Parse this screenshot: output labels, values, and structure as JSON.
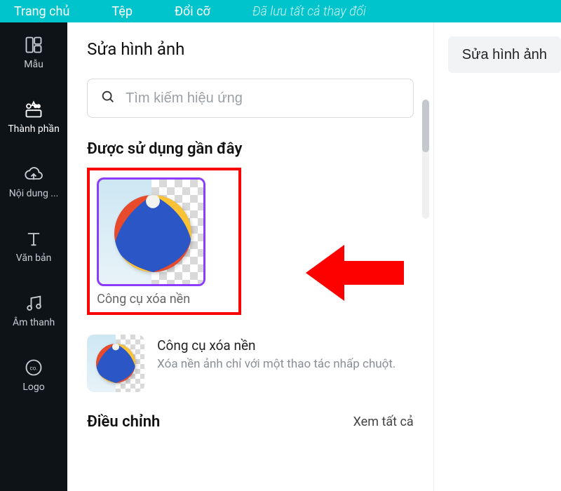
{
  "topbar": {
    "home": "Trang chủ",
    "file": "Tệp",
    "resize": "Đổi cỡ",
    "saved": "Đã lưu tất cả thay đổi"
  },
  "rail": {
    "templates": "Mẫu",
    "elements": "Thành phần",
    "uploads": "Nội dung ...",
    "text": "Văn bản",
    "audio": "Âm thanh",
    "logo": "Logo"
  },
  "panel": {
    "title": "Sửa hình ảnh",
    "search_placeholder": "Tìm kiếm hiệu ứng",
    "recent_title": "Được sử dụng gần đây",
    "effect_thumb_label": "Công cụ xóa nền",
    "row_title": "Công cụ xóa nền",
    "row_desc": "Xóa nền ảnh chỉ với một thao tác nhấp chuột.",
    "adjust_title": "Điều chỉnh",
    "see_all": "Xem tất cả"
  },
  "right": {
    "edit_image": "Sửa hình ảnh"
  }
}
